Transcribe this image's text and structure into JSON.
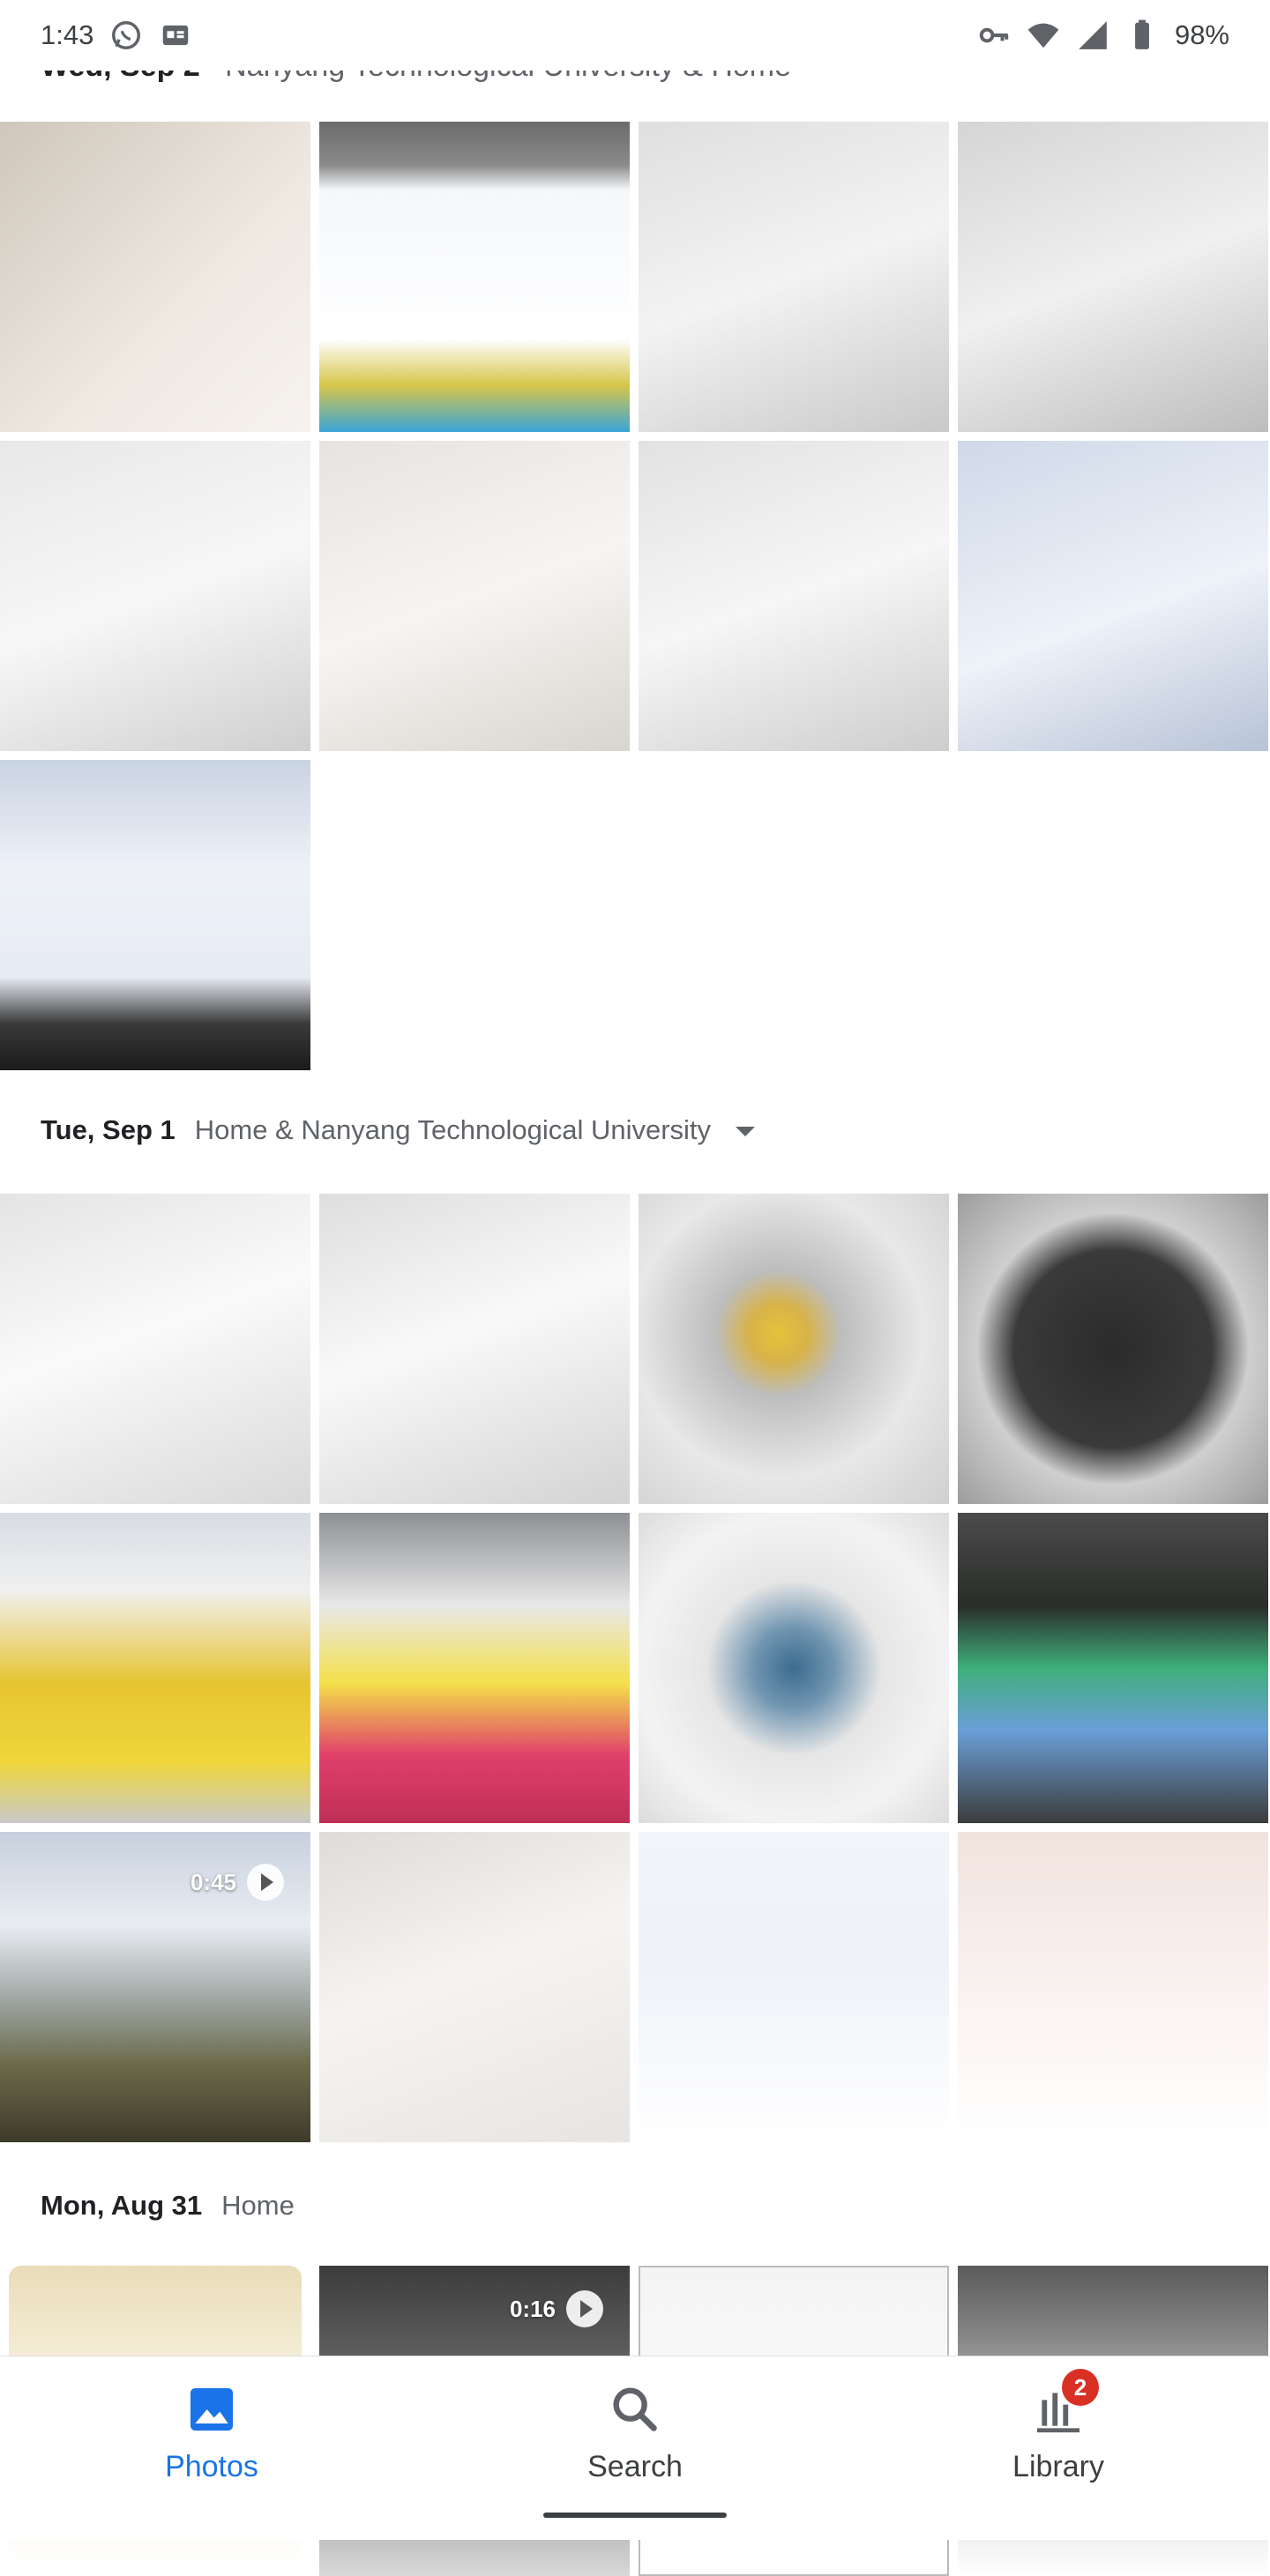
{
  "status_bar": {
    "time": "1:43",
    "battery": "98%",
    "icons": [
      "whatsapp-icon",
      "gmail-card-icon",
      "vpn-key-icon",
      "wifi-icon",
      "signal-icon",
      "battery-icon"
    ]
  },
  "partial_header": {
    "date": "Wed, Sep 2",
    "location": "Nanyang Technological University & Home"
  },
  "sections": [
    {
      "date": "Tue, Sep 1",
      "location": "Home & Nanyang Technological University"
    },
    {
      "date": "Mon, Aug 31",
      "location": "Home"
    }
  ],
  "videos": {
    "sep1_video": "0:45",
    "aug31_video": "0:16"
  },
  "nav": {
    "photos": "Photos",
    "search": "Search",
    "library": "Library",
    "library_badge": "2"
  },
  "colors": {
    "accent": "#1a73e8",
    "badge": "#d93025"
  }
}
